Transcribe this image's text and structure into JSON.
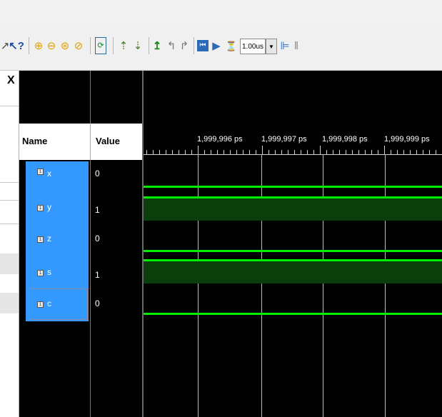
{
  "toolbar": {
    "zoom_value": "1.00us",
    "zoom_dropdown_icon": "chevron-down-icon",
    "icons": [
      "cursor-icon",
      "help-pointer-icon",
      "zoom-in-icon",
      "zoom-out-icon",
      "zoom-fit-icon",
      "zoom-cursor-icon",
      "goto-time-icon",
      "swap-up-icon",
      "swap-down-icon",
      "marker-icon",
      "previous-transition-icon",
      "next-transition-icon",
      "go-to-start-icon",
      "run-icon",
      "time-step-icon",
      "wave-config-icon",
      "pause-icon"
    ]
  },
  "panel": {
    "close_label": "X"
  },
  "columns": {
    "name": "Name",
    "value": "Value"
  },
  "signals": [
    {
      "name": "x",
      "value": "0"
    },
    {
      "name": "y",
      "value": "1"
    },
    {
      "name": "z",
      "value": "0"
    },
    {
      "name": "s",
      "value": "1"
    },
    {
      "name": "c",
      "value": "0"
    }
  ],
  "timeline": {
    "labels": [
      "1,999,996 ps",
      "1,999,997 ps",
      "1,999,998 ps",
      "1,999,999 ps"
    ]
  },
  "colors": {
    "wave_high": "#00ee00",
    "wave_fill": "#0a3e0a",
    "selection": "#3399ff",
    "background": "#000000"
  }
}
